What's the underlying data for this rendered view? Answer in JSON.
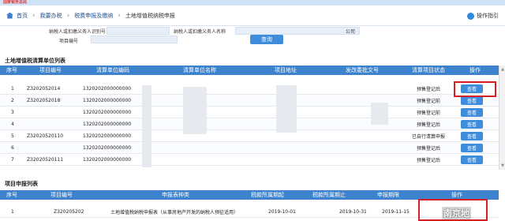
{
  "header": {
    "logo_text": "国家税务总局",
    "breadcrumb": [
      "首页",
      "我要办税",
      "税费申报及缴纳",
      "土地增值税纳税申报"
    ],
    "guide_label": "操作指引"
  },
  "form": {
    "taxpayer_id_label": "纳税人或扣缴义务人识别号",
    "taxpayer_name_label": "纳税人或扣缴义务人名称",
    "taxpayer_name_value_tail": "公司",
    "project_no_label": "项目编号",
    "search_label": "查询"
  },
  "settlement_table": {
    "title": "土地增值税清算单位列表",
    "columns": [
      "序号",
      "项目编号",
      "清算单位编码",
      "清算单位名称",
      "项目地址",
      "发改委批文号",
      "清算项目状态",
      "操作"
    ],
    "rows": [
      {
        "no": "1",
        "project_no": "Z3202052014",
        "unit_code": "1320202000000000",
        "status": "预售登记后",
        "action": "查看"
      },
      {
        "no": "2",
        "project_no": "Z3202052018",
        "unit_code": "1320202000000000",
        "status": "预售登记前",
        "action": "查看"
      },
      {
        "no": "3",
        "project_no": "",
        "unit_code": "1320202000000000",
        "status": "预售登记前",
        "action": "查看"
      },
      {
        "no": "4",
        "project_no": "",
        "unit_code": "1320202000000000",
        "status": "预售登记后",
        "action": "查看"
      },
      {
        "no": "5",
        "project_no": "Z32020520110",
        "unit_code": "1320202000000000",
        "status": "已自行清算申报",
        "action": "查看"
      },
      {
        "no": "6",
        "project_no": "",
        "unit_code": "1320202000000000",
        "status": "预售登记后",
        "action": "查看"
      },
      {
        "no": "7",
        "project_no": "Z32020520111",
        "unit_code": "1320202000000000",
        "status": "预售登记后",
        "action": "查看"
      }
    ]
  },
  "declaration_table": {
    "title": "项目申报列表",
    "columns": [
      "序号",
      "项目编号",
      "申报表种类",
      "税款所属期起",
      "税款所属期止",
      "申报期限",
      "操作"
    ],
    "rows": [
      {
        "no": "1",
        "project_no": "Z320205202",
        "form_type": "土地增值税纳税申报表（从事房地产开发的纳税人预征适用）",
        "period_start": "2019-10-01",
        "period_end": "2019-10-31",
        "deadline": "2019-11-15"
      }
    ]
  },
  "watermark": "南京地"
}
